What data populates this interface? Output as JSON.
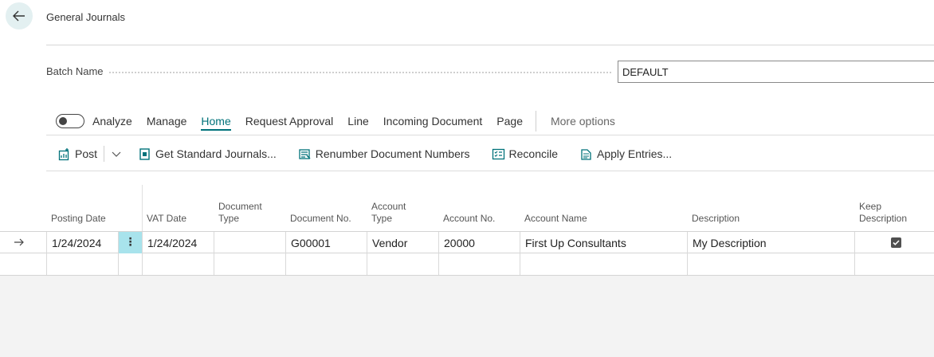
{
  "header": {
    "title": "General Journals"
  },
  "batch": {
    "label": "Batch Name",
    "value": "DEFAULT"
  },
  "actions": [
    "Analyze",
    "Manage",
    "Home",
    "Request Approval",
    "Line",
    "Incoming Document",
    "Page"
  ],
  "actions_active": "Home",
  "more_options": "More options",
  "toolbar": {
    "post": "Post",
    "get_standard": "Get Standard Journals...",
    "renumber": "Renumber Document Numbers",
    "reconcile": "Reconcile",
    "apply": "Apply Entries..."
  },
  "columns": {
    "posting_date": "Posting Date",
    "vat_date": "VAT Date",
    "document_type": "Document Type",
    "document_no": "Document No.",
    "account_type": "Account Type",
    "account_no": "Account No.",
    "account_name": "Account Name",
    "description": "Description",
    "keep_description": "Keep Description"
  },
  "rows": [
    {
      "posting_date": "1/24/2024",
      "vat_date": "1/24/2024",
      "document_type": "",
      "document_no": "G00001",
      "account_type": "Vendor",
      "account_no": "20000",
      "account_name": "First Up Consultants",
      "description": "My Description",
      "keep_description": true
    }
  ],
  "colors": {
    "accent": "#00727a",
    "selected_cell": "#a8e3ec"
  }
}
